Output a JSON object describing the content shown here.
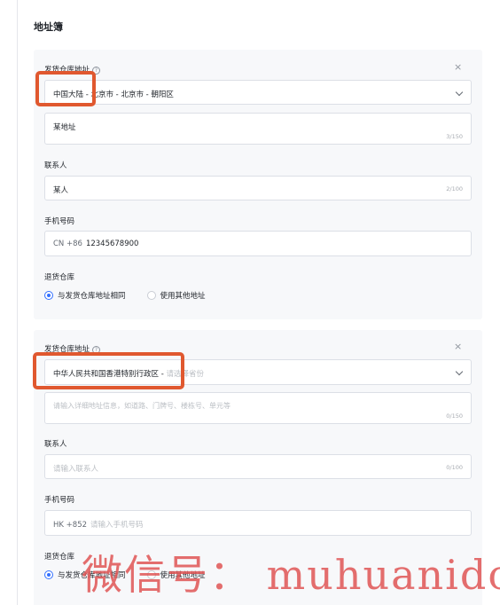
{
  "page": {
    "title": "地址簿"
  },
  "cards": [
    {
      "warehouse_label": "发货仓库地址",
      "help_icon": "?",
      "close_icon": "×",
      "region_value": "中国大陆 - 北京市 - 北京市 - 朝阳区",
      "region_placeholder": "",
      "address_value": "某地址",
      "address_placeholder": "",
      "address_counter": "3/150",
      "contact_label": "联系人",
      "contact_value": "某人",
      "contact_placeholder": "",
      "contact_counter": "2/100",
      "phone_label": "手机号码",
      "phone_prefix": "CN +86",
      "phone_value": "12345678900",
      "phone_placeholder": "",
      "return_label": "退货仓库",
      "return_option_same": "与发货仓库地址相同",
      "return_option_other": "使用其他地址",
      "return_selected": "same"
    },
    {
      "warehouse_label": "发货仓库地址",
      "help_icon": "?",
      "close_icon": "×",
      "region_value": "中华人民共和国香港特别行政区 -",
      "region_placeholder": "请选择省份",
      "address_value": "",
      "address_placeholder": "请输入详细地址信息，如道路、门牌号、楼栋号、单元等",
      "address_counter": "0/150",
      "contact_label": "联系人",
      "contact_value": "",
      "contact_placeholder": "请输入联系人",
      "contact_counter": "0/100",
      "phone_label": "手机号码",
      "phone_prefix": "HK +852",
      "phone_value": "",
      "phone_placeholder": "请输入手机号码",
      "return_label": "退货仓库",
      "return_option_same": "与发货仓库地址相同",
      "return_option_other": "使用其他地址",
      "return_selected": "same"
    }
  ],
  "watermark": "微信号： muhuanidc",
  "colors": {
    "accent": "#3370ff",
    "highlight": "#e0582f",
    "watermark": "#e05555"
  }
}
